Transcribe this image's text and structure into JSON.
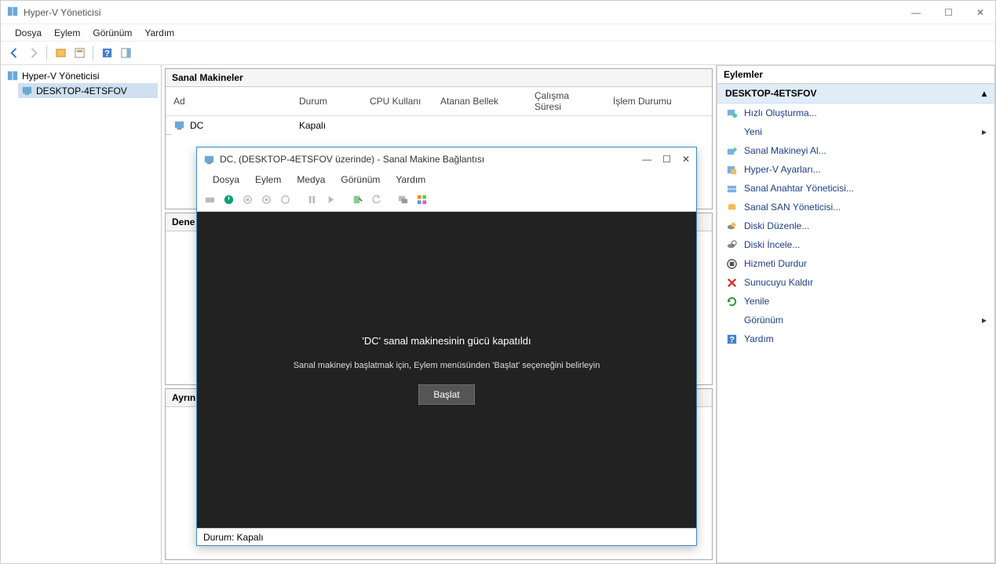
{
  "window": {
    "title": "Hyper-V Yöneticisi",
    "menu": [
      "Dosya",
      "Eylem",
      "Görünüm",
      "Yardım"
    ]
  },
  "tree": {
    "root": "Hyper-V Yöneticisi",
    "child": "DESKTOP-4ETSFOV"
  },
  "vmpanel": {
    "title": "Sanal Makineler",
    "cols": {
      "name": "Ad",
      "state": "Durum",
      "cpu": "CPU Kullanı",
      "mem": "Atanan Bellek",
      "uptime": "Çalışma Süresi",
      "job": "İşlem Durumu"
    },
    "rows": [
      {
        "name": "DC",
        "state": "Kapalı"
      }
    ]
  },
  "checkpanel": {
    "title": "Dene"
  },
  "detailpanel": {
    "title": "Ayrın"
  },
  "actions": {
    "header": "Eylemler",
    "section": "DESKTOP-4ETSFOV",
    "items": {
      "quick": "Hızlı Oluşturma...",
      "new": "Yeni",
      "import": "Sanal Makineyi Al...",
      "settings": "Hyper-V Ayarları...",
      "vswitch": "Sanal Anahtar Yöneticisi...",
      "vsan": "Sanal SAN Yöneticisi...",
      "editdisk": "Diski Düzenle...",
      "inspectdisk": "Diski İncele...",
      "stopsvc": "Hizmeti Durdur",
      "removesrv": "Sunucuyu Kaldır",
      "refresh": "Yenile",
      "view": "Görünüm",
      "help": "Yardım"
    }
  },
  "vmconn": {
    "title": "DC, (DESKTOP-4ETSFOV üzerinde) - Sanal Makine Bağlantısı",
    "menu": [
      "Dosya",
      "Eylem",
      "Medya",
      "Görünüm",
      "Yardım"
    ],
    "msg1": "'DC' sanal makinesinin gücü kapatıldı",
    "msg2": "Sanal makineyi başlatmak için, Eylem menüsünden 'Başlat' seçeneğini belirleyin",
    "startbtn": "Başlat",
    "status_label": "Durum:",
    "status_value": "Kapalı"
  }
}
